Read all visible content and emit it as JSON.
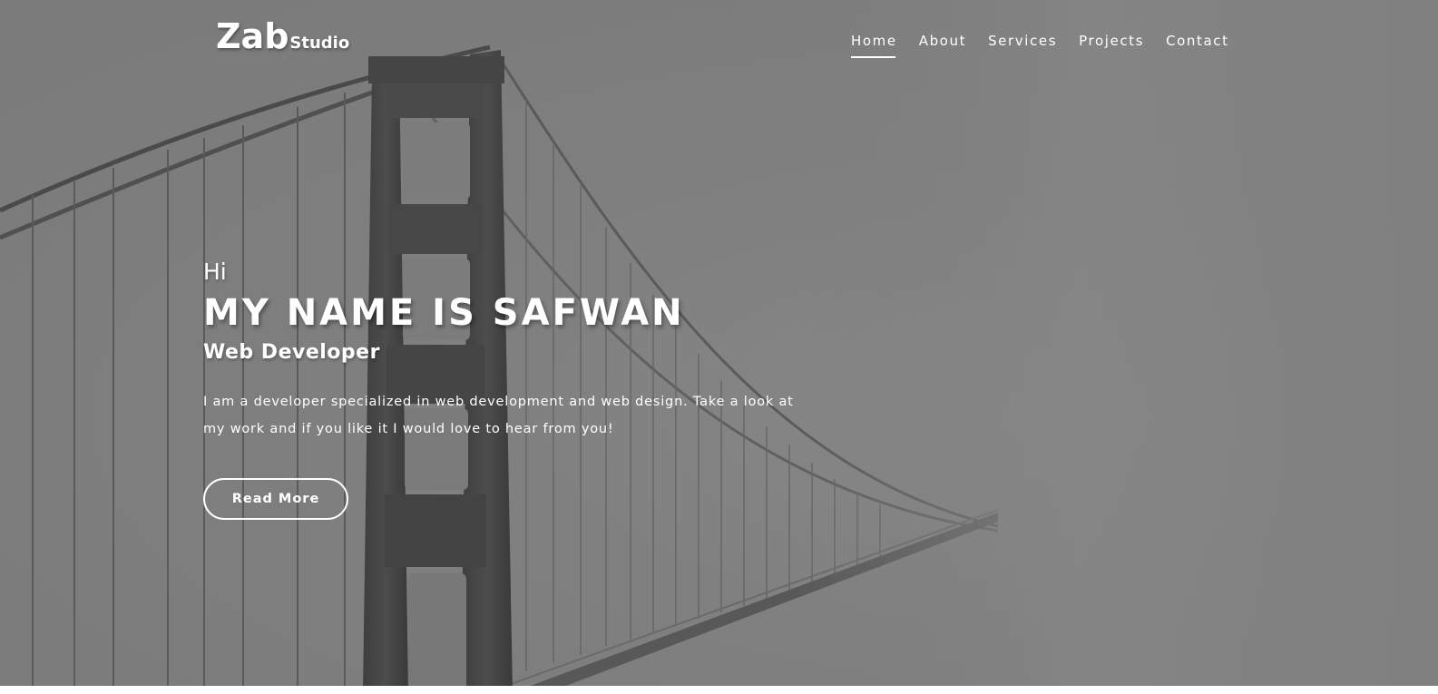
{
  "logo": {
    "main": "Zab",
    "sub": "Studio"
  },
  "nav": {
    "items": [
      {
        "label": "Home",
        "active": true
      },
      {
        "label": "About",
        "active": false
      },
      {
        "label": "Services",
        "active": false
      },
      {
        "label": "Projects",
        "active": false
      },
      {
        "label": "Contact",
        "active": false
      }
    ]
  },
  "hero": {
    "greeting": "Hi",
    "name": "MY NAME IS SAFWAN",
    "role": "Web Developer",
    "description": "I am a developer specialized in web development and web design. Take a look at my work and if you like it I would love to hear from you!",
    "button_label": "Read More"
  },
  "colors": {
    "background": "#7e7e7e",
    "text": "#ffffff",
    "bridge": "#4a4a4a"
  }
}
